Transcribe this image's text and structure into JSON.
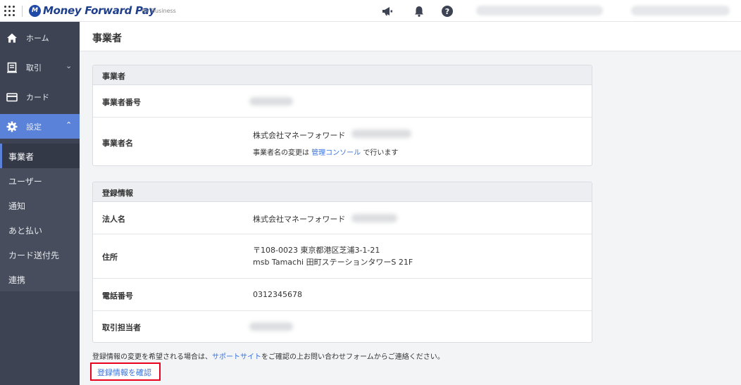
{
  "header": {
    "logo_mark": "M",
    "logo_text": "Money Forward Pay",
    "logo_sub": "for Business"
  },
  "sidebar": {
    "items": [
      {
        "label": "ホーム",
        "icon": "home-icon"
      },
      {
        "label": "取引",
        "icon": "receipt-icon",
        "chevron": "⌄"
      },
      {
        "label": "カード",
        "icon": "card-icon"
      },
      {
        "label": "設定",
        "icon": "gear-icon",
        "chevron": "⌃"
      }
    ],
    "sub_items": [
      {
        "label": "事業者"
      },
      {
        "label": "ユーザー"
      },
      {
        "label": "通知"
      },
      {
        "label": "あと払い"
      },
      {
        "label": "カード送付先"
      },
      {
        "label": "連携"
      }
    ]
  },
  "main": {
    "title": "事業者",
    "business_card": {
      "heading": "事業者",
      "number_label": "事業者番号",
      "name_label": "事業者名",
      "name_value": "株式会社マネーフォワード",
      "name_note_prefix": "事業者名の変更は ",
      "name_note_link": "管理コンソール",
      "name_note_suffix": " で行います"
    },
    "registration_card": {
      "heading": "登録情報",
      "corp_label": "法人名",
      "corp_value": "株式会社マネーフォワード",
      "address_label": "住所",
      "address_line1": "〒108-0023 東京都港区芝浦3-1-21",
      "address_line2": "msb Tamachi 田町ステーションタワーS 21F",
      "phone_label": "電話番号",
      "phone_value": "0312345678",
      "contact_label": "取引担当者"
    },
    "note_prefix": "登録情報の変更を希望される場合は、",
    "note_link": "サポートサイト",
    "note_suffix": "をご確認の上お問い合わせフォームからご連絡ください。",
    "confirm_button": "登録情報を確認"
  },
  "colors": {
    "sidebar_bg": "#3d4352",
    "sidebar_active": "#5a82d8",
    "link": "#3a72d8",
    "highlight": "#e8001c"
  }
}
